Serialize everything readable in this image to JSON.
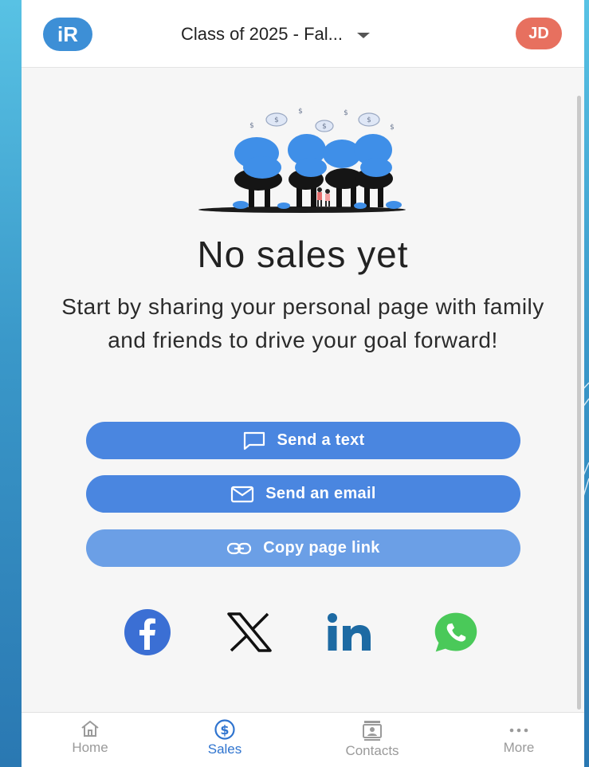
{
  "header": {
    "logo_text": "iR",
    "team_selector": "Class of 2025 - Fal...",
    "avatar_initials": "JD"
  },
  "empty_state": {
    "title": "No sales yet",
    "message": "Start by sharing your personal page with family and friends to drive your goal forward!"
  },
  "actions": {
    "send_text": "Send a text",
    "send_email": "Send an email",
    "copy_link": "Copy page link"
  },
  "social": [
    "facebook-icon",
    "x-icon",
    "linkedin-icon",
    "whatsapp-icon"
  ],
  "bottom_nav": {
    "items": [
      {
        "label": "Home",
        "icon": "home-icon"
      },
      {
        "label": "Sales",
        "icon": "dollar-icon",
        "active": true
      },
      {
        "label": "Contacts",
        "icon": "contacts-icon"
      },
      {
        "label": "More",
        "icon": "more-icon"
      }
    ]
  },
  "colors": {
    "primary": "#4a86e0",
    "avatar": "#e7705f",
    "facebook": "#3b6fd4",
    "linkedin": "#1d6aa3",
    "whatsapp": "#4ac959"
  }
}
